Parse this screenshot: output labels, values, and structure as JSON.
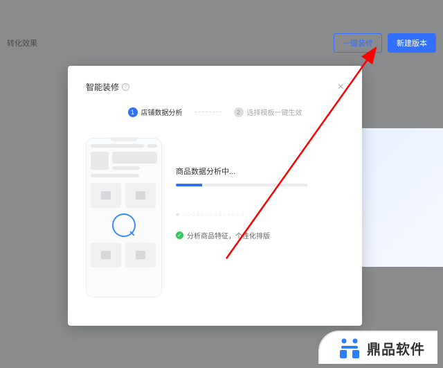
{
  "header": {
    "breadcrumb": "转化效果",
    "buttons": {
      "outline": "一键装修",
      "primary": "新建版本"
    }
  },
  "modal": {
    "title": "智能装修",
    "steps": [
      {
        "num": "1",
        "label": "店铺数据分析"
      },
      {
        "num": "2",
        "label": "选择模板一键生效"
      }
    ],
    "analysis": {
      "title": "商品数据分析中...",
      "status": "分析商品特征，个性化排版"
    }
  },
  "watermark": {
    "text": "鼎品软件"
  }
}
